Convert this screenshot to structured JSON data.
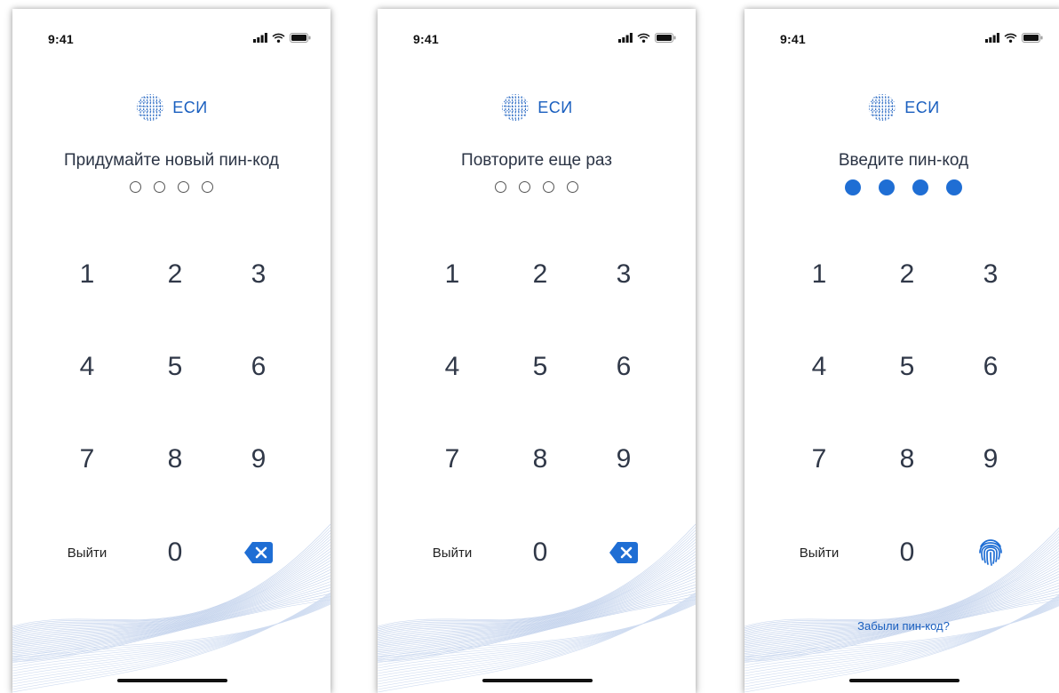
{
  "status_bar": {
    "time": "9:41",
    "icons": [
      "signal-icon",
      "wifi-icon",
      "battery-icon"
    ]
  },
  "brand": {
    "name": "ЕСИ",
    "icon": "globe-logo-icon",
    "color": "#1a5fbf"
  },
  "accent_color": "#1f6ed4",
  "keypad": {
    "digits": [
      "1",
      "2",
      "3",
      "4",
      "5",
      "6",
      "7",
      "8",
      "9",
      "0"
    ],
    "exit_label": "Выйти",
    "backspace_icon": "backspace-icon",
    "fingerprint_icon": "fingerprint-icon"
  },
  "screens": [
    {
      "prompt": "Придумайте новый пин-код",
      "pin_length": 4,
      "entered": 0,
      "action_key": "backspace"
    },
    {
      "prompt": "Повторите еще раз",
      "pin_length": 4,
      "entered": 0,
      "action_key": "backspace"
    },
    {
      "prompt": "Введите пин-код",
      "pin_length": 4,
      "entered": 4,
      "action_key": "fingerprint",
      "forgot_label": "Забыли пин-код?"
    }
  ]
}
